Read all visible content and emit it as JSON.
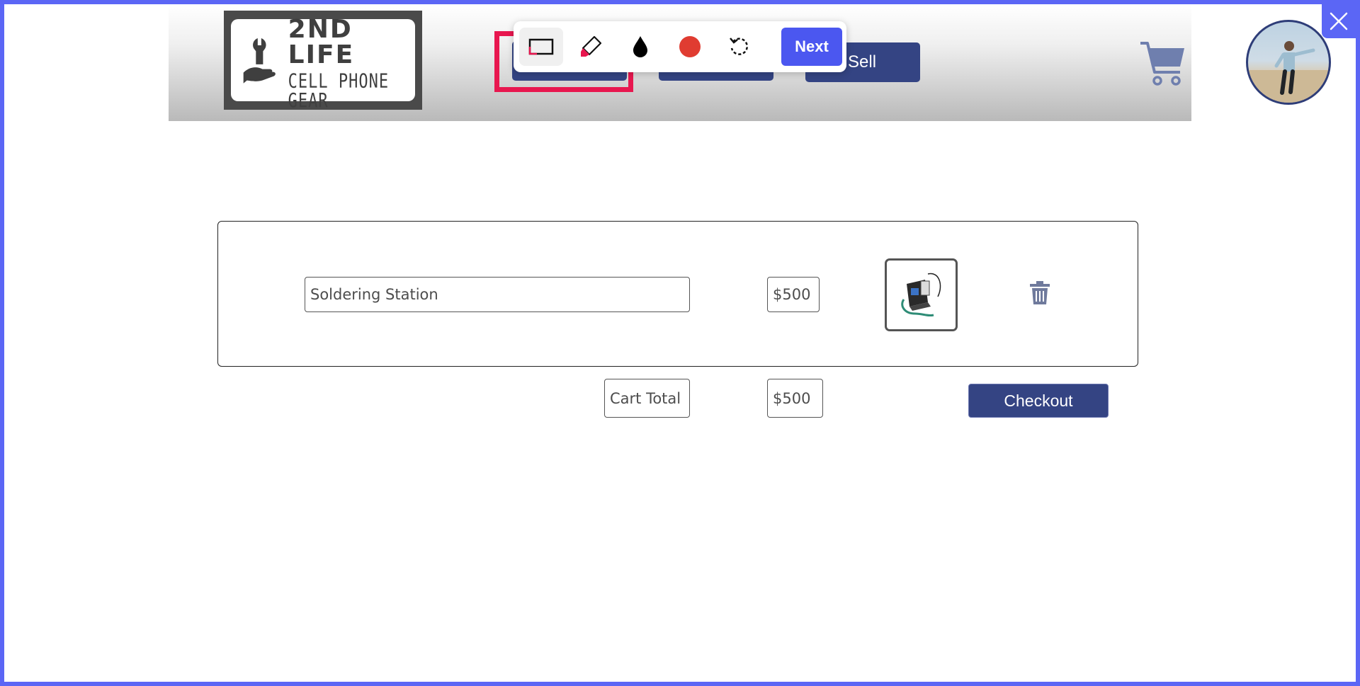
{
  "logo": {
    "line1": "2ND LIFE",
    "line2": "CELL PHONE GEAR"
  },
  "nav": {
    "sell_label": "Sell"
  },
  "toolbar": {
    "next_label": "Next",
    "accent_color": "#4b57f0",
    "dot_color": "#e03c31"
  },
  "cart": {
    "items": [
      {
        "name": "Soldering Station",
        "price": "$500",
        "image_icon": "soldering-station-image"
      }
    ],
    "total_label": "Cart Total",
    "total_value": "$500",
    "checkout_label": "Checkout"
  },
  "colors": {
    "frame": "#5b66f5",
    "brand_button": "#344483",
    "highlight": "#e8174f"
  }
}
